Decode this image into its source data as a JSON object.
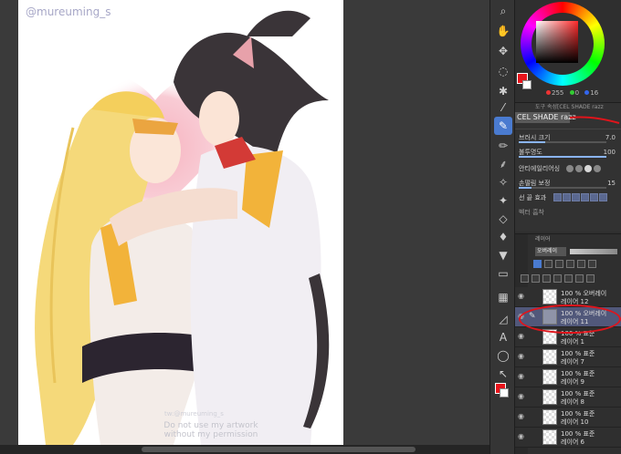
{
  "canvas": {
    "watermark_top": "@mureuming_s",
    "watermark_mid": "tw:@mureuming_s",
    "watermark_bottom_line1": "Do not use my artwork",
    "watermark_bottom_line2": "without my permission"
  },
  "color": {
    "main_color": "#e8141b",
    "sub_color": "#ffffff",
    "r": "255",
    "g": "0",
    "b": "16"
  },
  "tool_property": {
    "header": "도구 속성[CEL SHADE razz",
    "tool_name": "CEL SHADE razz",
    "brush_size_label": "브러시 크기",
    "brush_size_value": "7.0",
    "opacity_label": "불투명도",
    "opacity_value": "100",
    "antialias_label": "안티에일리어싱",
    "correction_label": "손떨림 보정",
    "correction_value": "15",
    "stroke_end_label": "선 끝 효과",
    "vector_label": "벡터 흡착"
  },
  "layers": {
    "panel_tab": "레이어",
    "blend_mode": "오버레이",
    "items": [
      {
        "mode": "100 % 오버레이",
        "name": "레이어 12",
        "selected": false
      },
      {
        "mode": "100 % 오버레이",
        "name": "레이어 11",
        "selected": true
      },
      {
        "mode": "100 % 표준",
        "name": "레이어 1",
        "selected": false
      },
      {
        "mode": "100 % 표준",
        "name": "레이어 7",
        "selected": false
      },
      {
        "mode": "100 % 표준",
        "name": "레이어 9",
        "selected": false
      },
      {
        "mode": "100 % 표준",
        "name": "레이어 8",
        "selected": false
      },
      {
        "mode": "100 % 표준",
        "name": "레이어 10",
        "selected": false
      },
      {
        "mode": "100 % 표준",
        "name": "레이어 6",
        "selected": false
      }
    ]
  },
  "tools": [
    "magnifier-icon",
    "hand-icon",
    "move-icon",
    "lasso-icon",
    "wand-icon",
    "eyedropper-icon",
    "pen-icon",
    "pencil-icon",
    "brush-icon",
    "airbrush-icon",
    "decoration-icon",
    "eraser-icon",
    "blend-icon",
    "fill-icon",
    "gradient-icon",
    "frame-icon",
    "ruler-icon",
    "text-icon",
    "balloon-icon",
    "correct-icon"
  ]
}
